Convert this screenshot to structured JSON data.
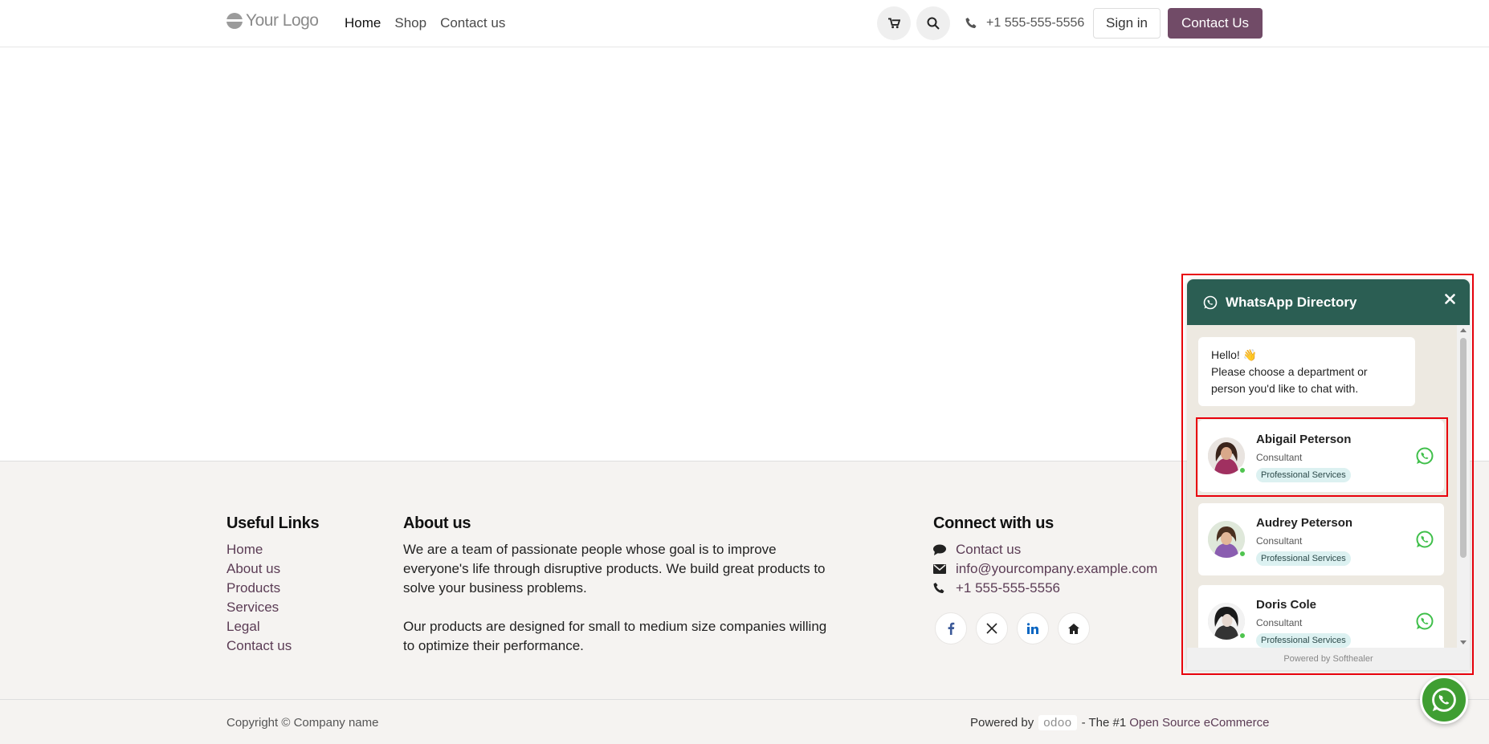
{
  "header": {
    "logo_text": "Your Logo",
    "nav": [
      "Home",
      "Shop",
      "Contact us"
    ],
    "phone": "+1 555-555-5556",
    "sign_in": "Sign in",
    "contact_button": "Contact Us"
  },
  "footer": {
    "useful_links_title": "Useful Links",
    "useful_links": [
      "Home",
      "About us",
      "Products",
      "Services",
      "Legal",
      "Contact us"
    ],
    "about_title": "About us",
    "about_p1": "We are a team of passionate people whose goal is to improve everyone's life through disruptive products. We build great products to solve your business problems.",
    "about_p2": "Our products are designed for small to medium size companies willing to optimize their performance.",
    "connect_title": "Connect with us",
    "connect_contact": "Contact us",
    "connect_email": "info@yourcompany.example.com",
    "connect_phone": "+1 555-555-5556",
    "socials": [
      "facebook-icon",
      "x-icon",
      "linkedin-icon",
      "home-icon"
    ],
    "copyright": "Copyright © Company name",
    "powered_by": "Powered by",
    "odoo": "odoo",
    "tagline_prefix": "- The #1",
    "tagline_link": "Open Source eCommerce"
  },
  "whatsapp": {
    "title": "WhatsApp Directory",
    "greeting_line1": "Hello! 👋",
    "greeting_line2": "Please choose a department or person you'd like to chat with.",
    "agents": [
      {
        "name": "Abigail Peterson",
        "role": "Consultant",
        "department": "Professional Services"
      },
      {
        "name": "Audrey Peterson",
        "role": "Consultant",
        "department": "Professional Services"
      },
      {
        "name": "Doris Cole",
        "role": "Consultant",
        "department": "Professional Services"
      }
    ],
    "footer": "Powered by Softhealer"
  },
  "colors": {
    "brand": "#714b67",
    "whatsapp_header": "#2b5e53",
    "whatsapp_green": "#3f9e32"
  }
}
